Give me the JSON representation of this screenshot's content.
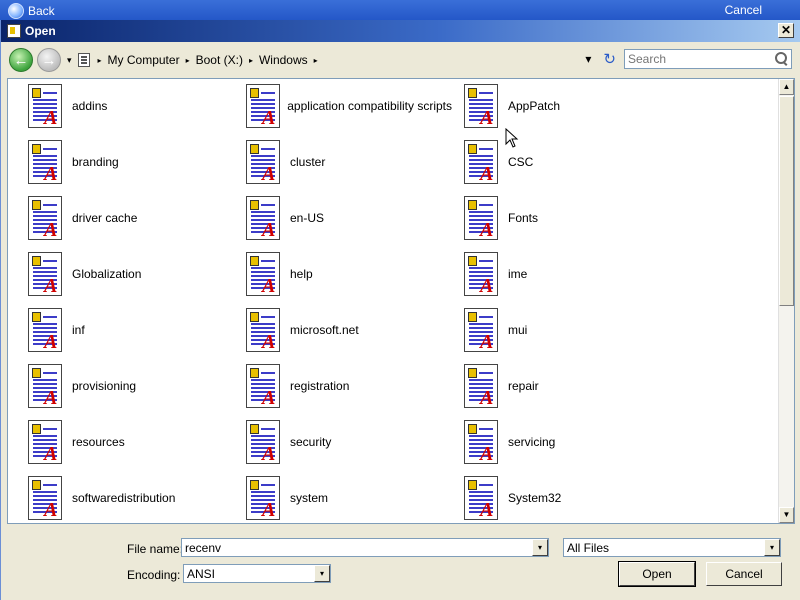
{
  "background": {
    "back_label": "Back",
    "cancel_label": "Cancel"
  },
  "window": {
    "title": "Open",
    "close_glyph": "✕"
  },
  "nav": {
    "back_glyph": "←",
    "forward_glyph": "→",
    "dropdown_glyph": "▾",
    "separator_glyph": "▸",
    "breadcrumb": [
      "My Computer",
      "Boot (X:)",
      "Windows"
    ],
    "refresh_glyph": "↻"
  },
  "search": {
    "placeholder": "Search"
  },
  "files": [
    "addins",
    "application compatibility scripts",
    "AppPatch",
    "branding",
    "cluster",
    "CSC",
    "driver cache",
    "en-US",
    "Fonts",
    "Globalization",
    "help",
    "ime",
    "inf",
    "microsoft.net",
    "mui",
    "provisioning",
    "registration",
    "repair",
    "resources",
    "security",
    "servicing",
    "softwaredistribution",
    "system",
    "System32"
  ],
  "file_icon_letter": "A",
  "scroll": {
    "up_glyph": "▲",
    "down_glyph": "▼"
  },
  "footer": {
    "file_name_label": "File name:",
    "file_name_value": "recenv",
    "file_type_value": "All Files",
    "encoding_label": "Encoding:",
    "encoding_value": "ANSI",
    "open_label": "Open",
    "cancel_label": "Cancel"
  },
  "colors": {
    "title_start": "#0a246a",
    "title_end": "#a6caf0",
    "dialog_bg": "#ece9d8",
    "icon_lines": "#3c3cc8",
    "icon_letter": "#d00000"
  }
}
